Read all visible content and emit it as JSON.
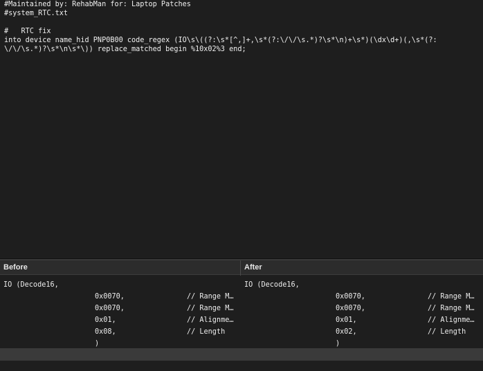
{
  "editor": {
    "lines": [
      "#Maintained by: RehabMan for: Laptop Patches",
      "#system_RTC.txt",
      "",
      "#   RTC fix",
      "into device name_hid PNP0B00 code_regex (IO\\s\\((?:\\s*[^,]+,\\s*(?:\\/\\/\\s.*)?\\s*\\n)+\\s*)(\\dx\\d+)(,\\s*(?:",
      "\\/\\/\\s.*)?\\s*\\n\\s*\\)) replace_matched begin %10x02%3 end;"
    ]
  },
  "diff": {
    "before": {
      "header": "Before",
      "rows": [
        [
          "IO (Decode16,",
          "",
          ""
        ],
        [
          "",
          "0x0070,",
          "// Range M…"
        ],
        [
          "",
          "0x0070,",
          "// Range M…"
        ],
        [
          "",
          "0x01,",
          "// Alignme…"
        ],
        [
          "",
          "0x08,",
          "// Length"
        ],
        [
          "",
          ")",
          ""
        ]
      ]
    },
    "after": {
      "header": "After",
      "rows": [
        [
          "IO (Decode16,",
          "",
          ""
        ],
        [
          "",
          "0x0070,",
          "// Range M…"
        ],
        [
          "",
          "0x0070,",
          "// Range M…"
        ],
        [
          "",
          "0x01,",
          "// Alignme…"
        ],
        [
          "",
          "0x02,",
          "// Length"
        ],
        [
          "",
          ")",
          ""
        ]
      ]
    }
  }
}
